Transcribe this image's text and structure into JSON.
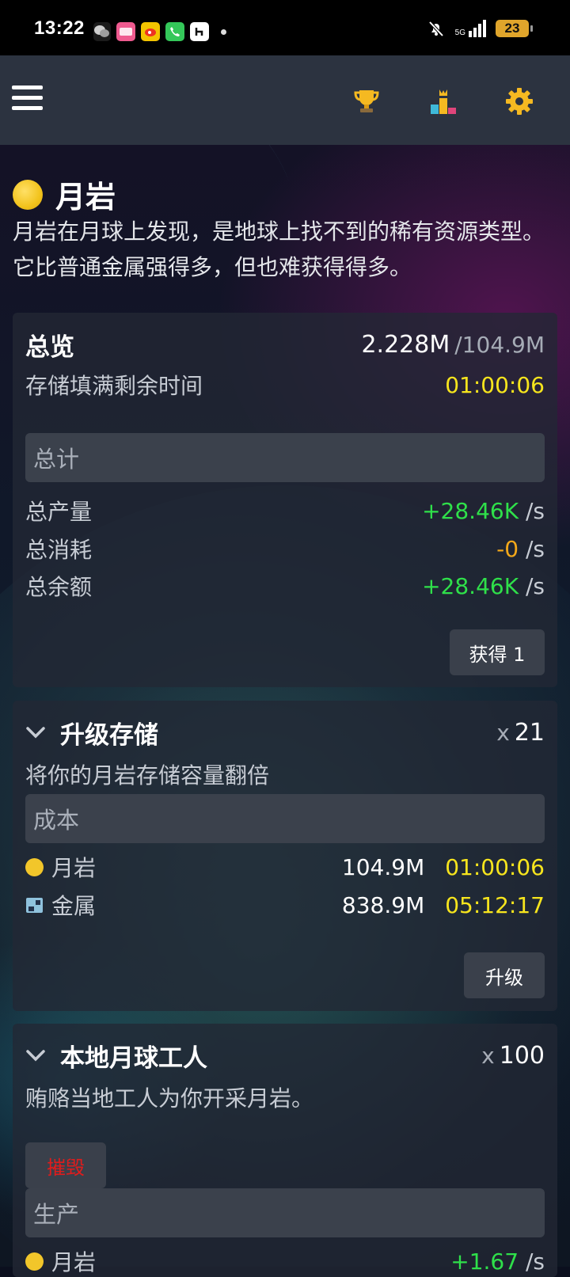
{
  "status_bar": {
    "time": "13:22",
    "network": "5G",
    "battery": "23"
  },
  "app_bar": {
    "icons": [
      "menu-icon",
      "trophy-icon",
      "leaderboard-icon",
      "gear-icon"
    ]
  },
  "resource": {
    "name": "月岩",
    "description": "月岩在月球上发现，是地球上找不到的稀有资源类型。它比普通金属强得多，但也难获得得多。",
    "icon_color": "#f2c62a"
  },
  "overview": {
    "title": "总览",
    "amount": "2.228M",
    "capacity": "/104.9M",
    "fill_label": "存储填满剩余时间",
    "fill_time": "01:00:06",
    "section_label": "总计",
    "rows": [
      {
        "label": "总产量",
        "value": "+28.46K",
        "unit": "/s"
      },
      {
        "label": "总消耗",
        "value": "-0",
        "unit": "/s"
      },
      {
        "label": "总余额",
        "value": "+28.46K",
        "unit": "/s"
      }
    ],
    "gain_button": "获得 1"
  },
  "upgrade_storage": {
    "title": "升级存储",
    "multiplier_x": "x",
    "multiplier": "21",
    "description": "将你的月岩存储容量翻倍",
    "section_label": "成本",
    "costs": [
      {
        "name": "月岩",
        "amount": "104.9M",
        "time": "01:00:06",
        "icon": "moonrock-icon"
      },
      {
        "name": "金属",
        "amount": "838.9M",
        "time": "05:12:17",
        "icon": "metal-icon"
      }
    ],
    "button": "升级"
  },
  "workers": {
    "title": "本地月球工人",
    "multiplier_x": "x",
    "multiplier": "100",
    "description": "贿赂当地工人为你开采月岩。",
    "destroy_button": "摧毁",
    "section_label": "生产",
    "production": [
      {
        "name": "月岩",
        "value": "+1.67",
        "unit": "/s"
      }
    ]
  },
  "colors": {
    "positive": "#2fe04a",
    "time": "#f7e51d",
    "zero": "#f3a81a",
    "destroy": "#e01c1c",
    "app_bar": "#2c3340"
  }
}
